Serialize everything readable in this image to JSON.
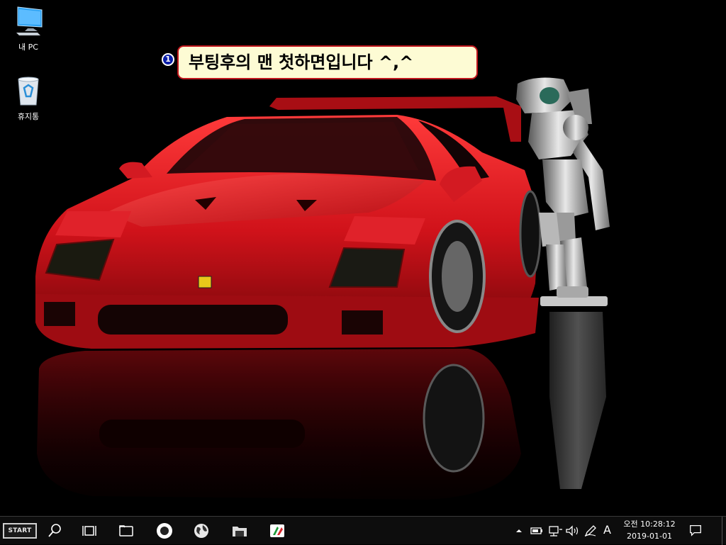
{
  "desktop": {
    "icons": [
      {
        "label": "내 PC",
        "icon": "computer-icon"
      },
      {
        "label": "휴지통",
        "icon": "recycle-bin-icon"
      }
    ],
    "callout": {
      "step": "1",
      "text": "부팅후의 맨 첫하면입니다 ^,^"
    },
    "wallpaper": "red sports car and robot on black background"
  },
  "taskbar": {
    "start_label": "START",
    "pinned": [
      "search-icon",
      "task-view-icon",
      "explorer-icon",
      "circle-app-icon",
      "globe-icon",
      "folder-icon",
      "tool-icon"
    ],
    "tray": {
      "overflow_icon": "chevron-up-icon",
      "ime": "A",
      "time_prefix": "오전",
      "time": "10:28:12",
      "date": "2019-01-01"
    }
  },
  "colors": {
    "car_red": "#c8141c",
    "callout_bg": "#fdfbd4",
    "callout_border": "#c0161d",
    "badge": "#0a1ea8"
  }
}
